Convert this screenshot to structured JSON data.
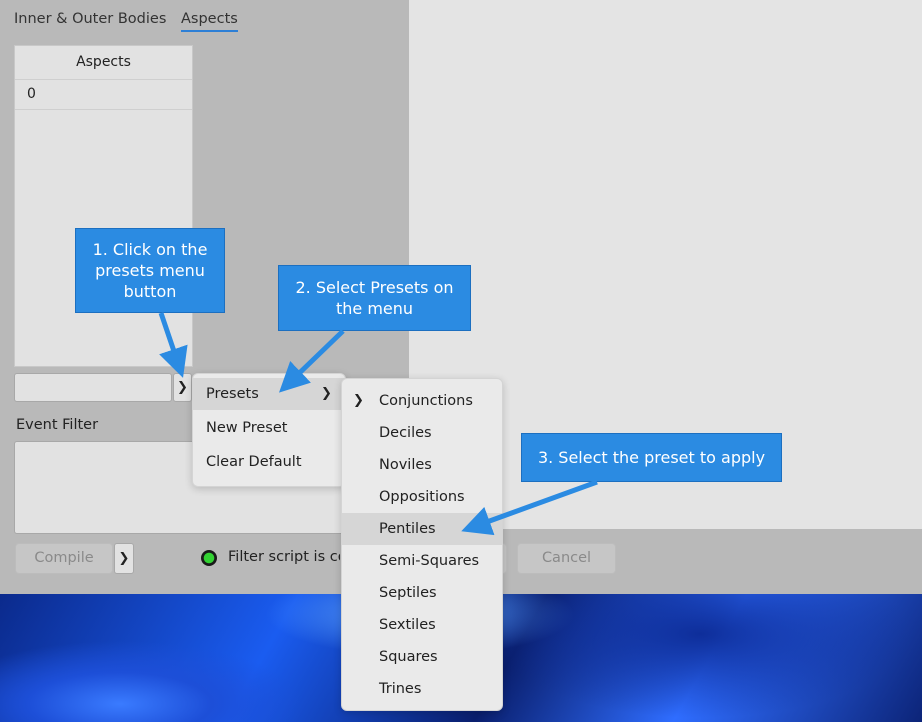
{
  "tabs": [
    "Inner & Outer Bodies",
    "Aspects"
  ],
  "aspects_table": {
    "header": "Aspects",
    "rows": [
      "0"
    ]
  },
  "event_filter_label": "Event Filter",
  "compile_label": "Compile",
  "cancel_label": "Cancel",
  "status_text": "Filter script is compiled",
  "menu": {
    "items": [
      "Presets",
      "New Preset",
      "Clear Default"
    ]
  },
  "presets_submenu": {
    "items": [
      "Conjunctions",
      "Deciles",
      "Noviles",
      "Oppositions",
      "Pentiles",
      "Semi-Squares",
      "Septiles",
      "Sextiles",
      "Squares",
      "Trines"
    ],
    "highlighted": "Pentiles"
  },
  "callouts": {
    "step1": "1. Click on the presets menu button",
    "step2": "2. Select Presets on the menu",
    "step3": "3. Select the preset to apply"
  },
  "colors": {
    "callout": "#2b8be2",
    "tab_underline": "#2d7fd6",
    "status_ok": "#33d233"
  },
  "icons": {
    "chevron": "chevron-right-icon",
    "status": "status-dot-icon"
  }
}
